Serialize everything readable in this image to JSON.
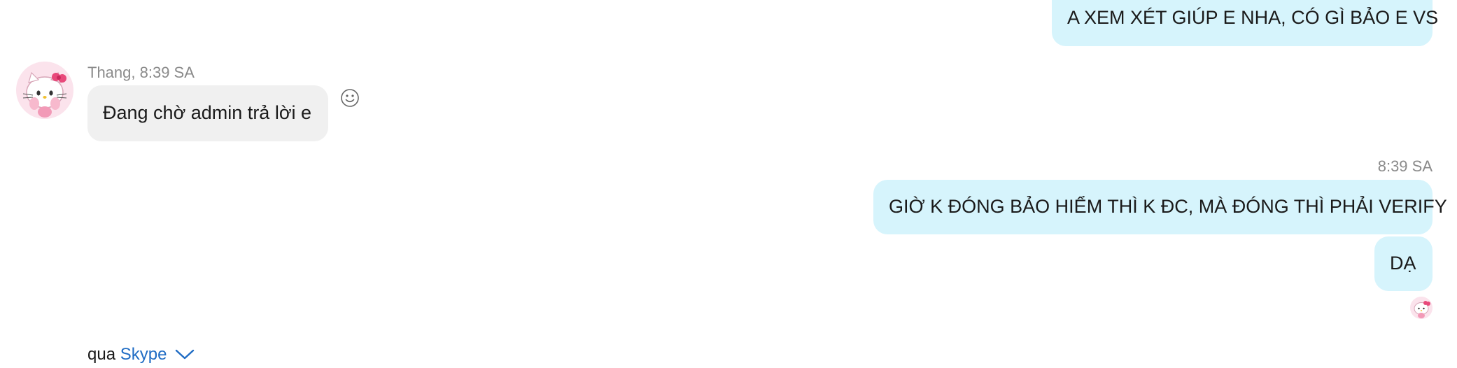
{
  "messages": {
    "outgoing_1": "A XEM XÉT GIÚP E NHA, CÓ GÌ BẢO E VS",
    "incoming_sender_time": "Thang, 8:39 SA",
    "incoming_1": "Đang chờ admin trả lời e",
    "outgoing_time": "8:39 SA",
    "outgoing_2": "GIỜ K ĐÓNG BẢO HIỂM THÌ K ĐC, MÀ ĐÓNG THÌ PHẢI VERIFY",
    "outgoing_3": "DẠ"
  },
  "footer": {
    "via_label": "qua",
    "service_name": "Skype"
  },
  "icons": {
    "avatar": "hello-kitty-avatar-icon",
    "react": "smiley-face-icon",
    "seen": "hello-kitty-seen-icon",
    "dropdown": "chevron-down-icon"
  },
  "colors": {
    "outgoing_bubble": "#d6f4fc",
    "incoming_bubble": "#f0f0f0",
    "link": "#1f6cc4",
    "meta_text": "#8a8a8a"
  }
}
